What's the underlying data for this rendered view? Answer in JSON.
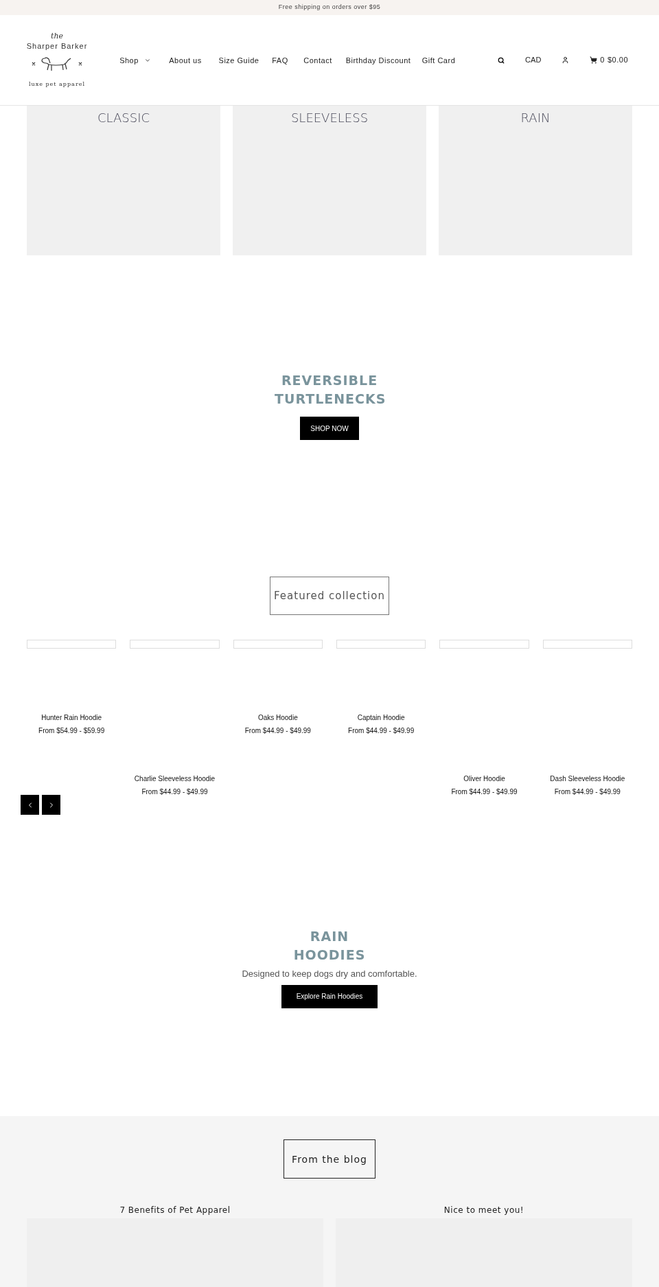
{
  "announcement": "Free shipping on orders over $95",
  "logo": {
    "top": "the",
    "name": "Sharper Barker",
    "tagline": "luxe pet apparel"
  },
  "nav": [
    {
      "label": "Shop",
      "kind": "dropdown"
    },
    {
      "label": "About us",
      "kind": "link"
    },
    {
      "label": "Size Guide",
      "kind": "link"
    },
    {
      "label": "FAQ",
      "kind": "link"
    },
    {
      "label": "Contact",
      "kind": "link"
    },
    {
      "label": "Birthday Discount",
      "kind": "link"
    },
    {
      "label": "Gift Card",
      "kind": "link"
    }
  ],
  "currency": "CAD",
  "cart": {
    "count": "0",
    "total": "$0.00"
  },
  "categories": [
    "CLASSIC",
    "SLEEVELESS",
    "RAIN"
  ],
  "hero": {
    "title": "REVERSIBLE TURTLENECKS",
    "button": "SHOP NOW"
  },
  "featured": {
    "title": "Featured collection",
    "products": [
      {
        "name": "Hunter Rain Hoodie",
        "price": "From $54.99 - $59.99",
        "kind": "upper"
      },
      {
        "name": "Charlie Sleeveless Hoodie",
        "price": "From $44.99 - $49.99",
        "kind": "lower"
      },
      {
        "name": "Oaks Hoodie",
        "price": "From $44.99 - $49.99",
        "kind": "upper"
      },
      {
        "name": "Captain Hoodie",
        "price": "From $44.99 - $49.99",
        "kind": "upper"
      },
      {
        "name": "Oliver Hoodie",
        "price": "From $44.99 - $49.99",
        "kind": "lower"
      },
      {
        "name": "Dash Sleeveless Hoodie",
        "price": "From $44.99 - $49.99",
        "kind": "lower"
      }
    ]
  },
  "rain": {
    "title": "RAIN HOODIES",
    "subtitle": "Designed to keep dogs dry and comfortable.",
    "button": "Explore Rain Hoodies"
  },
  "blog": {
    "title": "From the blog",
    "posts": [
      "7 Benefits of Pet Apparel",
      "Nice to meet you!"
    ]
  }
}
